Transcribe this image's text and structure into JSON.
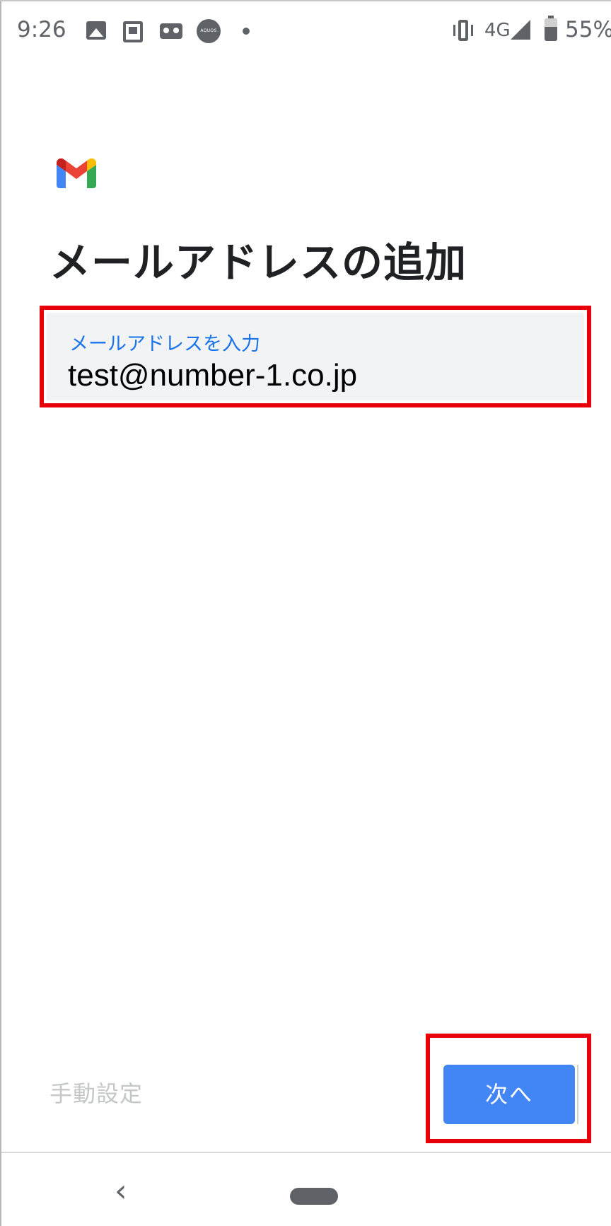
{
  "status_bar": {
    "time": "9:26",
    "aquos_label": "AQUOS",
    "network": "4G",
    "battery": "55%",
    "icons": [
      "image-icon",
      "sim-icon",
      "voicemail-icon",
      "aquos-icon",
      "notification-dot-icon",
      "vibrate-icon",
      "signal-icon",
      "battery-icon"
    ]
  },
  "app": {
    "logo": "gmail-logo",
    "brand_colors": {
      "red": "#EA4335",
      "blue": "#4285F4",
      "green": "#34A853",
      "yellow": "#FBBC04"
    }
  },
  "page": {
    "title": "メールアドレスの追加"
  },
  "email_field": {
    "label": "メールアドレスを入力",
    "value": "test@number-1.co.jp"
  },
  "footer": {
    "manual_setup": "手動設定",
    "next": "次へ"
  },
  "nav": {
    "back_glyph": "‹"
  },
  "colors": {
    "accent": "#4285F4",
    "label_blue": "#1A73E8",
    "highlight_red": "#E8000B",
    "field_bg": "#F1F3F4"
  }
}
